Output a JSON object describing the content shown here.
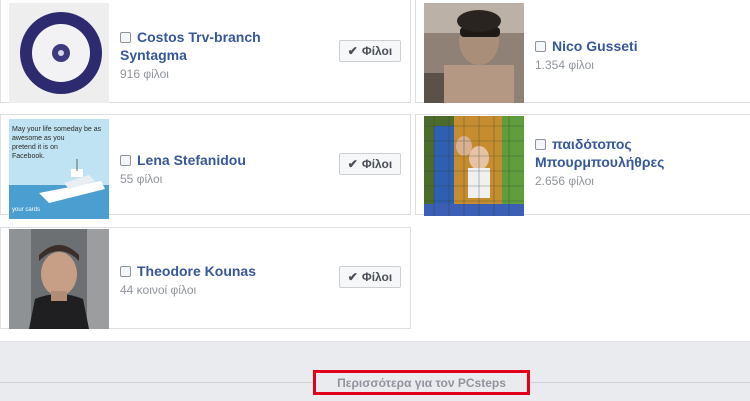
{
  "friends": [
    {
      "name": "Costos Trv-branch Syntagma",
      "name_line1": "Costos Trv-branch",
      "name_line2": "Syntagma",
      "meta": "916 φίλοι",
      "button": "Φίλοι"
    },
    {
      "name": "Nico Gusseti",
      "meta": "1.354 φίλοι"
    },
    {
      "name": "Lena Stefanidou",
      "meta": "55 φίλοι",
      "button": "Φίλοι",
      "thumb_text_lines": [
        "May your life someday be as",
        "awesome as you",
        "pretend it is on",
        "Facebook."
      ],
      "thumb_brand": "your cards"
    },
    {
      "name": "παιδότοπος Μπουρμπουλήθρες",
      "name_line1": "παιδότοπος",
      "name_line2": "Μπουρμπουλήθρες",
      "meta": "2.656 φίλοι"
    },
    {
      "name": "Theodore Kounas",
      "meta": "44 κοινοί φίλοι",
      "button": "Φίλοι"
    }
  ],
  "more_link": "Περισσότερα για τον PCsteps",
  "colors": {
    "link": "#365899",
    "muted": "#90949c",
    "border": "#dddfe2",
    "footer_bg": "#e9ebee",
    "highlight": "#e2001a"
  }
}
